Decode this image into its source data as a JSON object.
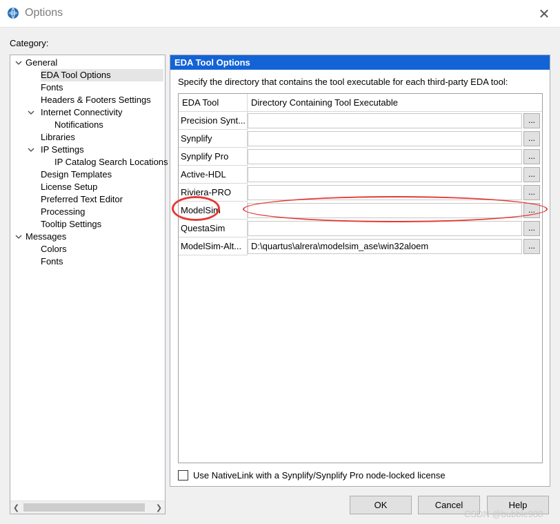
{
  "window": {
    "title": "Options",
    "close_icon": "close-icon",
    "app_icon": "quartus-globe-icon"
  },
  "category_label": "Category:",
  "tree": [
    {
      "label": "General",
      "expanded": true,
      "level": 0,
      "selected": false
    },
    {
      "label": "EDA Tool Options",
      "level": 1,
      "selected": true
    },
    {
      "label": "Fonts",
      "level": 1,
      "selected": false
    },
    {
      "label": "Headers & Footers Settings",
      "level": 1,
      "selected": false
    },
    {
      "label": "Internet Connectivity",
      "expanded": true,
      "level": 1,
      "selected": false
    },
    {
      "label": "Notifications",
      "level": 2,
      "selected": false
    },
    {
      "label": "Libraries",
      "level": 1,
      "selected": false
    },
    {
      "label": "IP Settings",
      "expanded": true,
      "level": 1,
      "selected": false
    },
    {
      "label": "IP Catalog Search Locations",
      "level": 2,
      "selected": false
    },
    {
      "label": "Design Templates",
      "level": 1,
      "selected": false
    },
    {
      "label": "License Setup",
      "level": 1,
      "selected": false
    },
    {
      "label": "Preferred Text Editor",
      "level": 1,
      "selected": false
    },
    {
      "label": "Processing",
      "level": 1,
      "selected": false
    },
    {
      "label": "Tooltip Settings",
      "level": 1,
      "selected": false
    },
    {
      "label": "Messages",
      "expanded": true,
      "level": 0,
      "selected": false
    },
    {
      "label": "Colors",
      "level": 1,
      "selected": false
    },
    {
      "label": "Fonts",
      "level": 1,
      "selected": false
    }
  ],
  "panel": {
    "header": "EDA Tool Options",
    "description": "Specify the directory that contains the tool executable for each third-party EDA tool:",
    "columns": [
      "EDA Tool",
      "Directory Containing Tool Executable"
    ],
    "rows": [
      {
        "name": "Precision Synt...",
        "path": ""
      },
      {
        "name": "Synplify",
        "path": ""
      },
      {
        "name": "Synplify Pro",
        "path": ""
      },
      {
        "name": "Active-HDL",
        "path": ""
      },
      {
        "name": "Riviera-PRO",
        "path": ""
      },
      {
        "name": "ModelSim",
        "path": ""
      },
      {
        "name": "QuestaSim",
        "path": ""
      },
      {
        "name": "ModelSim-Alt...",
        "path": "D:\\quartus\\alrera\\modelsim_ase\\win32aloem"
      }
    ],
    "browse_label": "...",
    "checkbox_label": "Use NativeLink with a Synplify/Synplify Pro node-locked license",
    "checkbox_checked": false
  },
  "buttons": {
    "ok": "OK",
    "cancel": "Cancel",
    "help": "Help"
  },
  "watermark": "CSDN @bubble988",
  "colors": {
    "header_bg": "#1363d6",
    "annotation": "#e53935"
  }
}
